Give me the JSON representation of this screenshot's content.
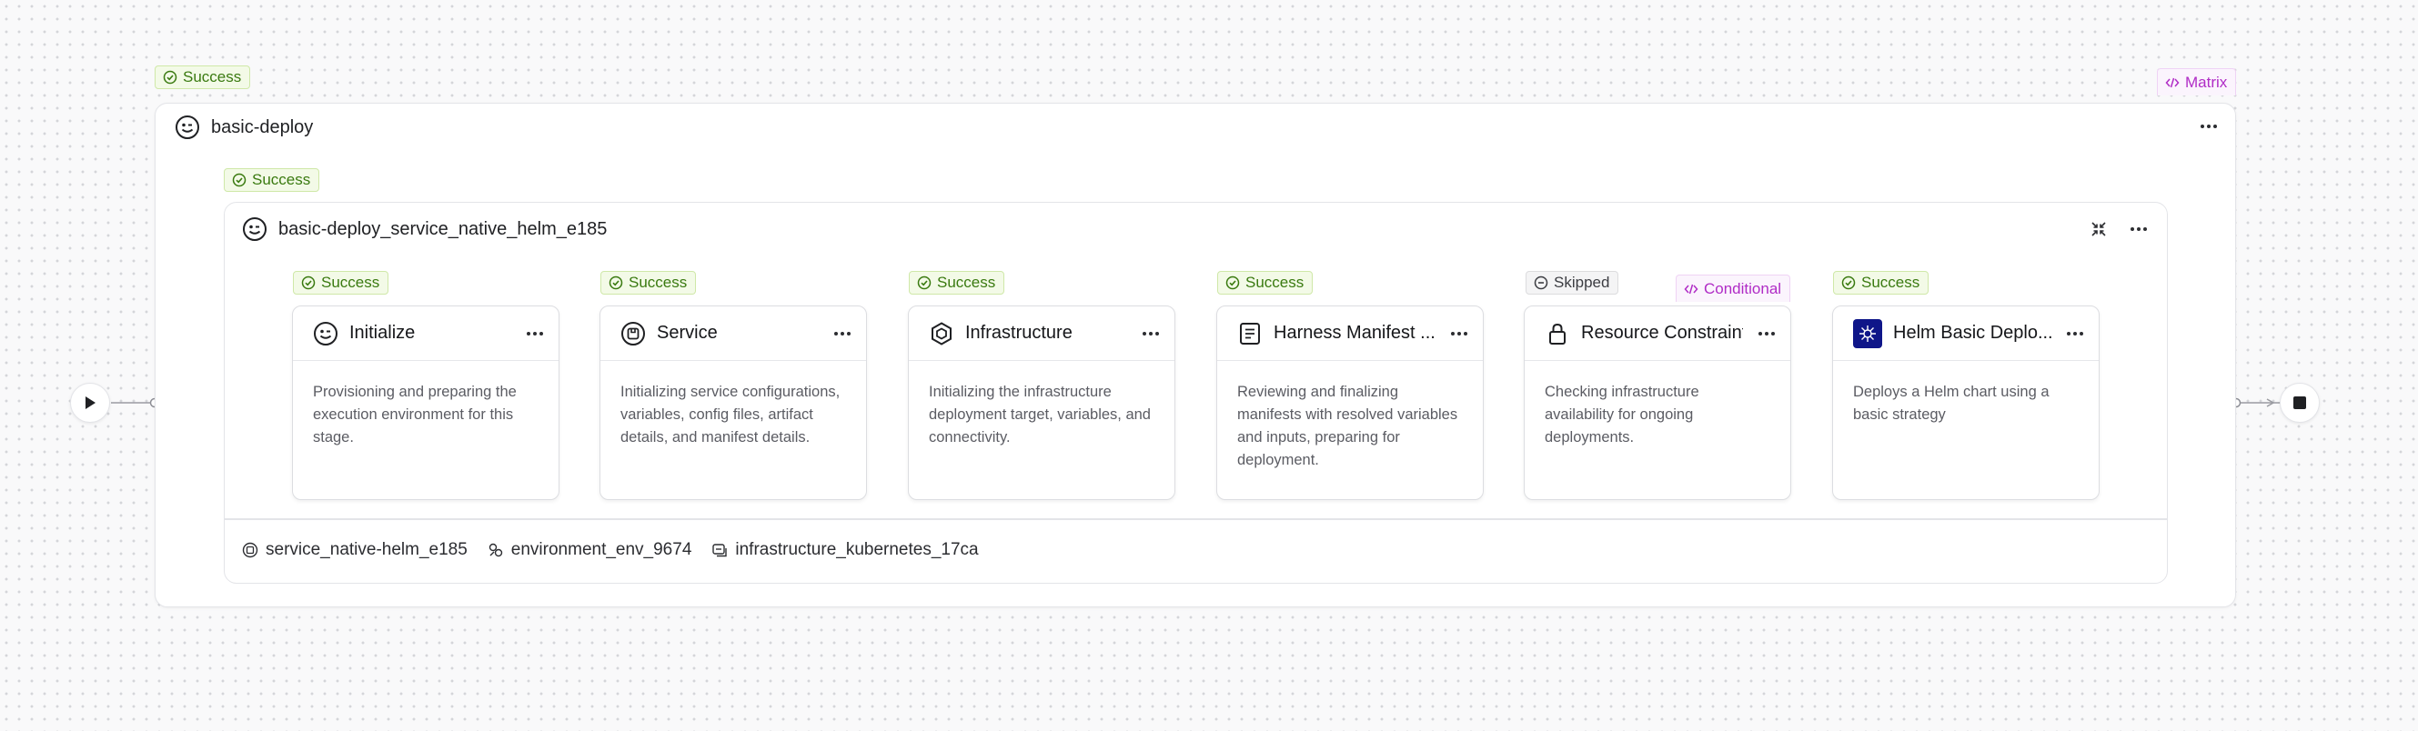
{
  "outer_stage": {
    "status": "Success",
    "title": "basic-deploy",
    "tag": "Matrix"
  },
  "inner_stage": {
    "status": "Success",
    "title": "basic-deploy_service_native_helm_e185"
  },
  "steps": [
    {
      "status": "Success",
      "title": "Initialize",
      "description": "Provisioning and preparing the execution environment for this stage."
    },
    {
      "status": "Success",
      "title": "Service",
      "description": "Initializing service configurations, variables, config files, artifact details, and manifest details."
    },
    {
      "status": "Success",
      "title": "Infrastructure",
      "description": "Initializing the infrastructure deployment target, variables, and connectivity."
    },
    {
      "status": "Success",
      "title": "Harness Manifest ...",
      "description": "Reviewing and finalizing manifests with resolved variables and inputs, preparing for deployment."
    },
    {
      "status": "Skipped",
      "title": "Resource Constraint",
      "tag": "Conditional",
      "description": "Checking infrastructure availability for ongoing deployments."
    },
    {
      "status": "Success",
      "title": "Helm Basic Deplo...",
      "description": "Deploys a Helm chart using a basic strategy"
    }
  ],
  "footer": {
    "service": "service_native-helm_e185",
    "environment": "environment_env_9674",
    "infrastructure": "infrastructure_kubernetes_17ca"
  },
  "icons": {
    "status_success": "check-circle-icon",
    "status_skipped": "minus-circle-icon",
    "tag": "code-brackets-icon",
    "stage": "stage-face-icon",
    "more": "more-horizontal-icon",
    "collapse": "collapse-icon",
    "play": "play-icon",
    "stop": "stop-icon"
  },
  "colors": {
    "success_text": "#3a7a10",
    "success_bg": "#f3fae7",
    "tag_text": "#b02cc6",
    "helm_bg": "#0f1689"
  }
}
